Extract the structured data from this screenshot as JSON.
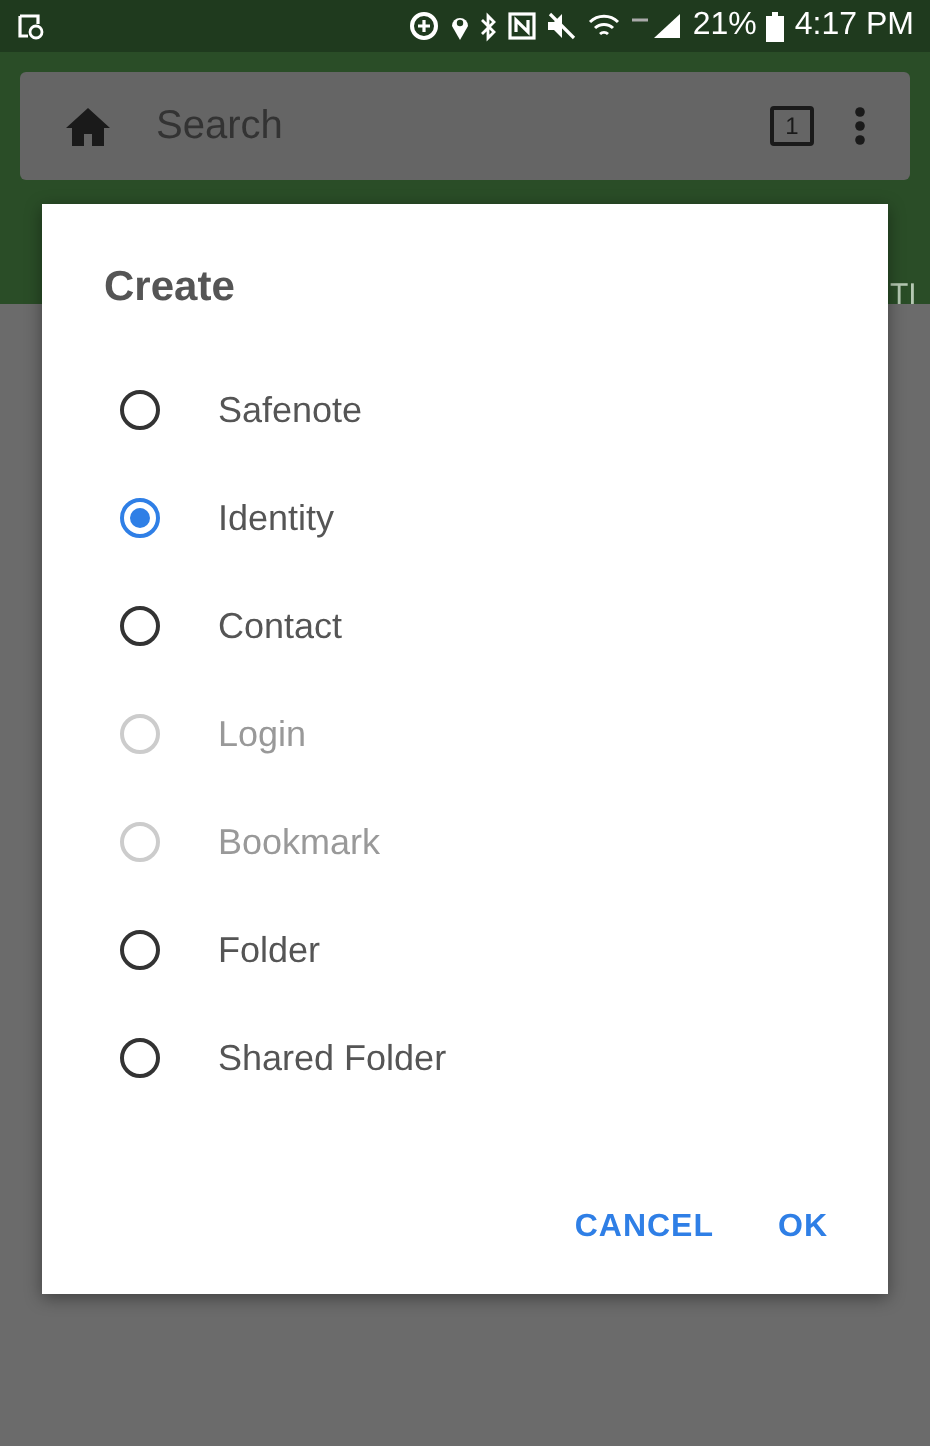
{
  "status_bar": {
    "battery": "21%",
    "time": "4:17 PM"
  },
  "toolbar": {
    "search": {
      "placeholder": "Search"
    },
    "tab_count": "1"
  },
  "tab_strip": {
    "cut_label": "TI"
  },
  "dialog": {
    "title": "Create",
    "options": [
      {
        "label": "Safenote",
        "selected": false,
        "disabled": false
      },
      {
        "label": "Identity",
        "selected": true,
        "disabled": false
      },
      {
        "label": "Contact",
        "selected": false,
        "disabled": false
      },
      {
        "label": "Login",
        "selected": false,
        "disabled": true
      },
      {
        "label": "Bookmark",
        "selected": false,
        "disabled": true
      },
      {
        "label": "Folder",
        "selected": false,
        "disabled": false
      },
      {
        "label": "Shared Folder",
        "selected": false,
        "disabled": false
      }
    ],
    "buttons": [
      "CANCEL",
      "OK"
    ]
  }
}
